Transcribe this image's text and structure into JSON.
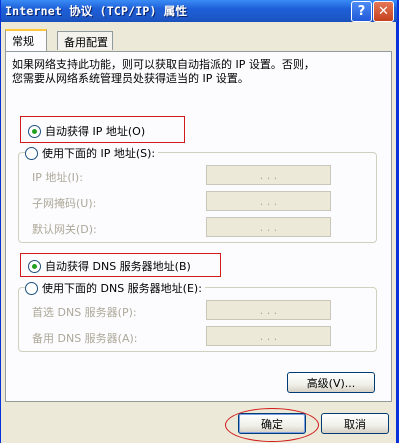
{
  "window": {
    "title": "Internet 协议 (TCP/IP) 属性",
    "help_glyph": "?",
    "close_glyph": "✕"
  },
  "tabs": [
    {
      "label": "常规"
    },
    {
      "label": "备用配置"
    }
  ],
  "description": "如果网络支持此功能，则可以获取自动指派的 IP 设置。否则，\n您需要从网络系统管理员处获得适当的 IP 设置。",
  "ip": {
    "auto_label": "自动获得 IP 地址(O)",
    "manual_label": "使用下面的 IP 地址(S):",
    "selected": "auto",
    "fields": [
      {
        "label": "IP 地址(I):",
        "value": ". . ."
      },
      {
        "label": "子网掩码(U):",
        "value": ". . ."
      },
      {
        "label": "默认网关(D):",
        "value": ". . ."
      }
    ]
  },
  "dns": {
    "auto_label": "自动获得 DNS 服务器地址(B)",
    "manual_label": "使用下面的 DNS 服务器地址(E):",
    "selected": "auto",
    "fields": [
      {
        "label": "首选 DNS 服务器(P):",
        "value": ". . ."
      },
      {
        "label": "备用 DNS 服务器(A):",
        "value": ". . ."
      }
    ]
  },
  "buttons": {
    "advanced": "高级(V)...",
    "ok": "确定",
    "cancel": "取消"
  },
  "colors": {
    "title_bar": "#1E5FD8",
    "annotation_red": "#D21A1A",
    "dialog_bg": "#ECE9D8",
    "radio_dot": "#21A121"
  }
}
